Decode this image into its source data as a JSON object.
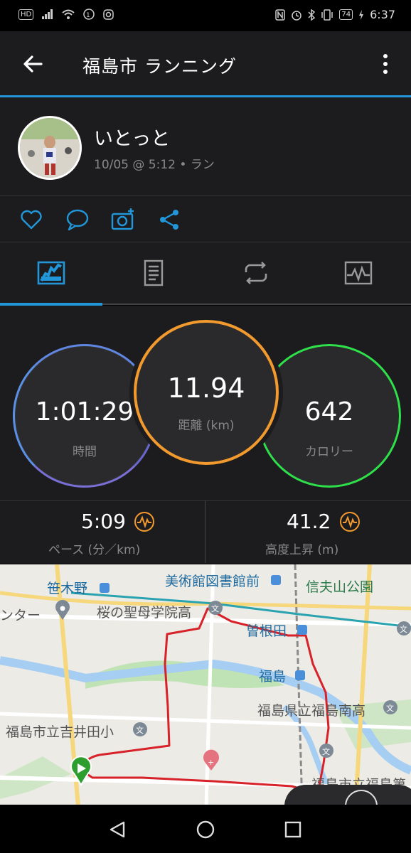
{
  "status_bar": {
    "left_badge": "HD",
    "battery": "74",
    "time": "6:37"
  },
  "app_bar": {
    "title": "福島市 ランニング"
  },
  "profile": {
    "name": "いとっと",
    "meta": "10/05 @ 5:12 • ラン"
  },
  "tabs": [
    "summary-chart-icon",
    "details-icon",
    "laps-icon",
    "graph-icon"
  ],
  "metrics": {
    "time": {
      "value": "1:01:29",
      "label": "時間",
      "color": "#7a6fd6"
    },
    "distance": {
      "value": "11.94",
      "label": "距離 (km)",
      "color": "#f29a2e"
    },
    "calories": {
      "value": "642",
      "label": "カロリー",
      "color": "#2ee04a"
    }
  },
  "stats": {
    "pace": {
      "value": "5:09",
      "label": "ペース (分／km)"
    },
    "ascent": {
      "value": "41.2",
      "label": "高度上昇 (m)"
    }
  },
  "map": {
    "labels": {
      "sasakino": "笹木野",
      "museum": "美術館図書館前",
      "shinobuyama": "信夫山公園",
      "center": "ンター",
      "school": "桜の聖母学院高",
      "sonedamachi": "曽根田",
      "fukushima": "福島",
      "minami_high": "福島県立福島南高",
      "yoshiida": "福島市立吉井田小",
      "fukushima_school2": "福島市立福島第"
    },
    "route_color": "#d8222a"
  }
}
